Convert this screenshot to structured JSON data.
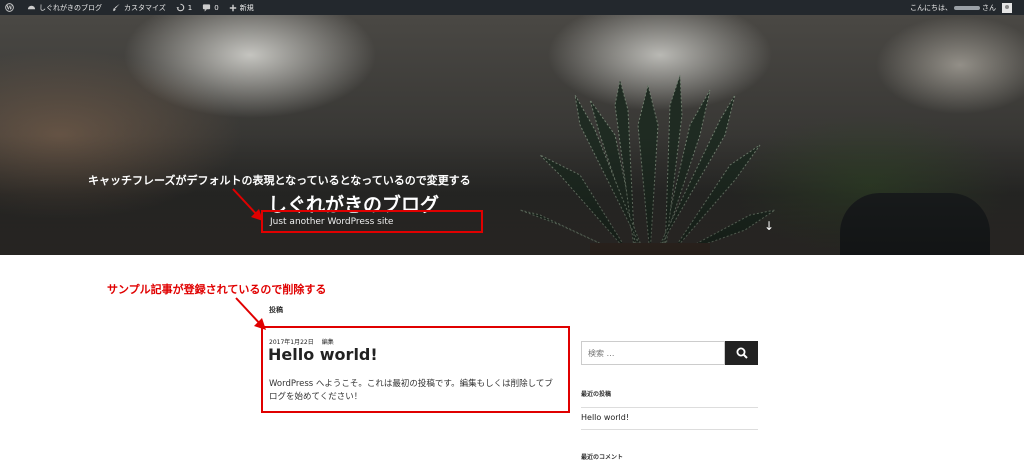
{
  "adminbar": {
    "site_name": "しぐれがきのブログ",
    "customize": "カスタマイズ",
    "updates_count": "1",
    "comments_count": "0",
    "new_label": "新規",
    "greeting_prefix": "こんにちは、",
    "greeting_suffix": "さん"
  },
  "header": {
    "site_title": "しぐれがきのブログ",
    "tagline": "Just another WordPress site",
    "scroll_arrow": "↓"
  },
  "annotations": {
    "tagline_note": "キャッチフレーズがデフォルトの表現となっているとなっているので変更する",
    "post_note": "サンプル記事が登録されているので削除する"
  },
  "main": {
    "section_label": "投稿",
    "post": {
      "date": "2017年1月22日",
      "edit_link": "編集",
      "title": "Hello world!",
      "body": "WordPress へようこそ。これは最初の投稿です。編集もしくは削除してブログを始めてください！"
    }
  },
  "sidebar": {
    "search_placeholder": "検索 …",
    "recent_posts_title": "最近の投稿",
    "recent_posts": [
      "Hello world!"
    ],
    "recent_comments_title": "最近のコメント"
  },
  "colors": {
    "annotation_red": "#e00000",
    "adminbar_bg": "#23282d"
  }
}
